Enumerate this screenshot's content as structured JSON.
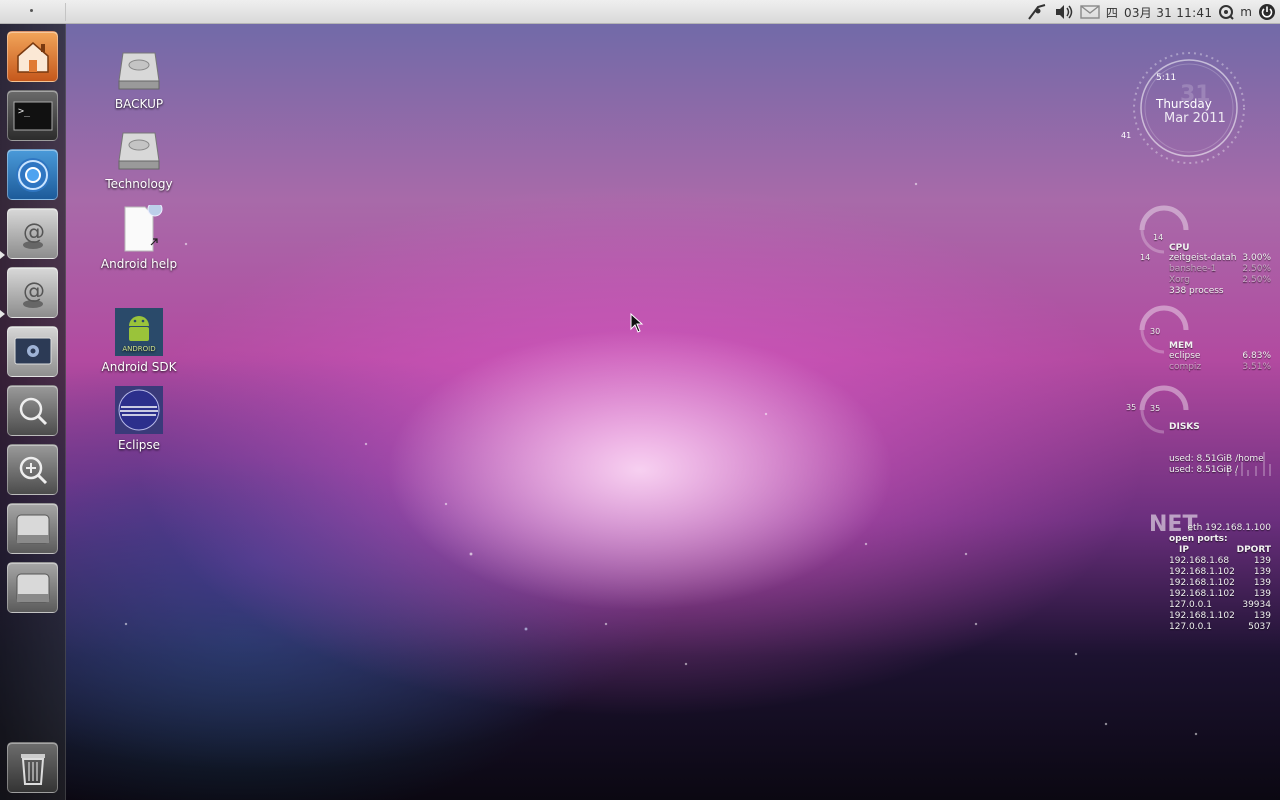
{
  "top_panel": {
    "weekday": "四",
    "datetime": "03月 31 11:41",
    "user": "m"
  },
  "launcher": {
    "items": [
      {
        "name": "home",
        "icon": "home-folder-icon"
      },
      {
        "name": "terminal",
        "icon": "terminal-icon",
        "glyph": ">_"
      },
      {
        "name": "chromium",
        "icon": "chromium-icon"
      },
      {
        "name": "mail-1",
        "icon": "mail-at-icon",
        "glyph": "@"
      },
      {
        "name": "mail-2",
        "icon": "mail-at-icon",
        "glyph": "@"
      },
      {
        "name": "settings",
        "icon": "settings-icon"
      },
      {
        "name": "search",
        "icon": "search-icon"
      },
      {
        "name": "zoom",
        "icon": "zoom-in-icon"
      },
      {
        "name": "drive-1",
        "icon": "hard-drive-icon"
      },
      {
        "name": "drive-2",
        "icon": "hard-drive-icon"
      },
      {
        "name": "trash",
        "icon": "trash-icon"
      }
    ]
  },
  "desktop": {
    "icons": [
      {
        "label": "BACKUP",
        "icon": "hard-drive-icon"
      },
      {
        "label": "Technology",
        "icon": "hard-drive-icon"
      },
      {
        "label": "Android help",
        "icon": "document-link-icon"
      },
      {
        "label": "Android SDK",
        "icon": "android-icon",
        "logo_text": "ANDROID"
      },
      {
        "label": "Eclipse",
        "icon": "eclipse-icon"
      }
    ]
  },
  "conky": {
    "clock": {
      "time": "5:11",
      "big_day": "31",
      "weekday": "Thursday",
      "date": "Mar 2011",
      "tick": "41"
    },
    "cpu": {
      "title": "CPU",
      "ring_value": "14",
      "ring_value_2": "14",
      "rows": [
        {
          "name": "zeitgeist-datah",
          "value": "3.00%"
        },
        {
          "name": "banshee-1",
          "value": "2.50%"
        },
        {
          "name": "Xorg",
          "value": "2.50%"
        }
      ],
      "process_count": "338 process"
    },
    "mem": {
      "title": "MEM",
      "ring_value": "30",
      "rows": [
        {
          "name": "eclipse",
          "value": "6.83%"
        },
        {
          "name": "compiz",
          "value": "3.51%"
        }
      ]
    },
    "disks": {
      "title": "DISKS",
      "ring_value": "35",
      "ring_value_2": "35",
      "rows": [
        "used: 8.51GiB /home",
        "used: 8.51GiB /"
      ]
    },
    "net": {
      "title": "NET",
      "interface": "eth 192.168.1.100",
      "open_ports_label": "open ports:",
      "col_ip": "IP",
      "col_dport": "DPORT",
      "rows": [
        {
          "ip": "192.168.1.68",
          "port": "139"
        },
        {
          "ip": "192.168.1.102",
          "port": "139"
        },
        {
          "ip": "192.168.1.102",
          "port": "139"
        },
        {
          "ip": "192.168.1.102",
          "port": "139"
        },
        {
          "ip": "127.0.0.1",
          "port": "39934"
        },
        {
          "ip": "192.168.1.102",
          "port": "139"
        },
        {
          "ip": "127.0.0.1",
          "port": "5037"
        }
      ]
    }
  },
  "colors": {
    "launcher_bg": "#232328",
    "panel_bg": "#e3e3e3",
    "home_orange": "#e07a34"
  }
}
